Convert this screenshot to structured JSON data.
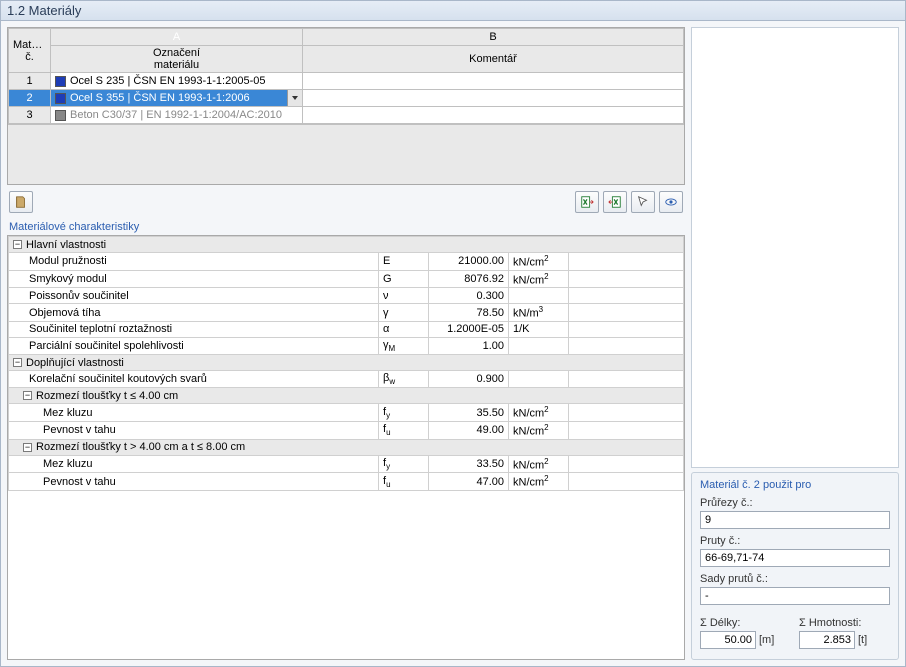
{
  "window": {
    "title": "1.2 Materiály"
  },
  "grid": {
    "cornerTop": "Materiál",
    "cornerBottom": "č.",
    "colA": "A",
    "colB": "B",
    "headerA1": "Označení",
    "headerA2": "materiálu",
    "headerB": "Komentář",
    "rows": [
      {
        "n": "1",
        "label": "Ocel S 235 | ČSN EN 1993-1-1:2005-05",
        "swatch": "blue",
        "selected": false,
        "disabled": false
      },
      {
        "n": "2",
        "label": "Ocel S 355 | ČSN EN 1993-1-1:2006",
        "swatch": "blue",
        "selected": true,
        "disabled": false
      },
      {
        "n": "3",
        "label": "Beton C30/37 | EN 1992-1-1:2004/AC:2010",
        "swatch": "gray",
        "selected": false,
        "disabled": true
      }
    ]
  },
  "sections": {
    "props_title": "Materiálové charakteristiky",
    "main_group": "Hlavní vlastnosti",
    "main": [
      {
        "name": "Modul pružnosti",
        "sym": "E",
        "val": "21000.00",
        "unit": "kN/cm2"
      },
      {
        "name": "Smykový modul",
        "sym": "G",
        "val": "8076.92",
        "unit": "kN/cm2"
      },
      {
        "name": "Poissonův součinitel",
        "sym": "ν",
        "val": "0.300",
        "unit": ""
      },
      {
        "name": "Objemová tíha",
        "sym": "γ",
        "val": "78.50",
        "unit": "kN/m3"
      },
      {
        "name": "Součinitel teplotní roztažnosti",
        "sym": "α",
        "val": "1.2000E-05",
        "unit": "1/K"
      },
      {
        "name": "Parciální součinitel spolehlivosti",
        "sym": "γM",
        "val": "1.00",
        "unit": ""
      }
    ],
    "extra_group": "Doplňující vlastnosti",
    "extra_scalar": {
      "name": "Korelační součinitel koutových svarů",
      "sym": "βw",
      "val": "0.900",
      "unit": ""
    },
    "range1_title": "Rozmezí tloušťky t ≤ 4.00 cm",
    "range1": [
      {
        "name": "Mez kluzu",
        "sym": "fy",
        "val": "35.50",
        "unit": "kN/cm2"
      },
      {
        "name": "Pevnost v tahu",
        "sym": "fu",
        "val": "49.00",
        "unit": "kN/cm2"
      }
    ],
    "range2_title": "Rozmezí tloušťky t > 4.00 cm a t ≤ 8.00 cm",
    "range2": [
      {
        "name": "Mez kluzu",
        "sym": "fy",
        "val": "33.50",
        "unit": "kN/cm2"
      },
      {
        "name": "Pevnost v tahu",
        "sym": "fu",
        "val": "47.00",
        "unit": "kN/cm2"
      }
    ]
  },
  "side": {
    "title": "Materiál č. 2 použit pro",
    "sections_label": "Průřezy č.:",
    "sections_value": "9",
    "members_label": "Pruty č.:",
    "members_value": "66-69,71-74",
    "sets_label": "Sady prutů č.:",
    "sets_value": "-",
    "sum_len_label": "Σ Délky:",
    "sum_len_value": "50.00",
    "sum_len_unit": "[m]",
    "sum_mass_label": "Σ Hmotnosti:",
    "sum_mass_value": "2.853",
    "sum_mass_unit": "[t]"
  }
}
